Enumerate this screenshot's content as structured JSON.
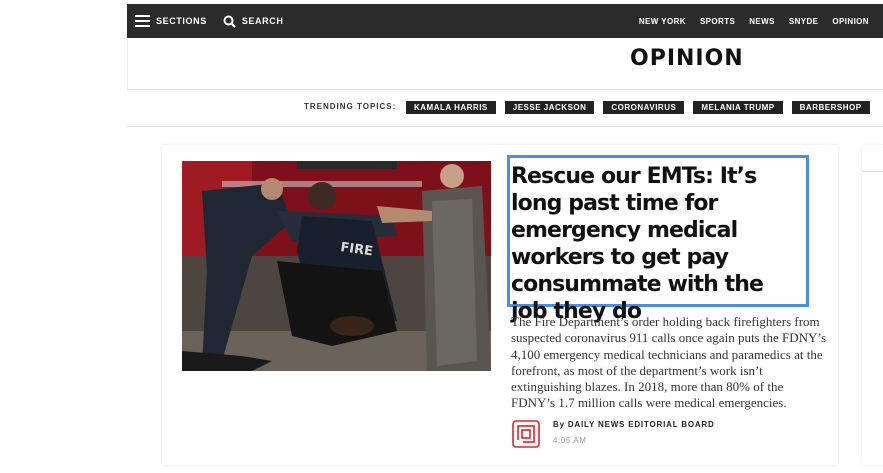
{
  "nav": {
    "sections_label": "SECTIONS",
    "search_label": "SEARCH",
    "links": [
      "NEW YORK",
      "SPORTS",
      "NEWS",
      "SNYDE",
      "OPINION"
    ]
  },
  "page": {
    "title": "OPINION"
  },
  "trending": {
    "label": "TRENDING TOPICS:",
    "topics": [
      "KAMALA HARRIS",
      "JESSE JACKSON",
      "CORONAVIRUS",
      "MELANIA TRUMP",
      "BARBERSHOP"
    ]
  },
  "article": {
    "headline": "Rescue our EMTs: It’s long past time for emergency medical workers to get pay consummate with the job they do",
    "summary": "The Fire Department’s order holding back firefighters from suspected coronavirus 911 calls once again puts the FDNY’s 4,100 emergency medical technicians and paramedics at the forefront, as most of the department’s work isn’t extinguishing blazes. In 2018, more than 80% of the FDNY’s 1.7 million calls were medical emergencies.",
    "byline": "By DAILY NEWS EDITORIAL BOARD",
    "time": "4:05 AM",
    "photo_text": "FIRE"
  },
  "colors": {
    "topbar": "#2b2b2b",
    "highlight": "#4a90e2",
    "logo": "#d9262b"
  }
}
